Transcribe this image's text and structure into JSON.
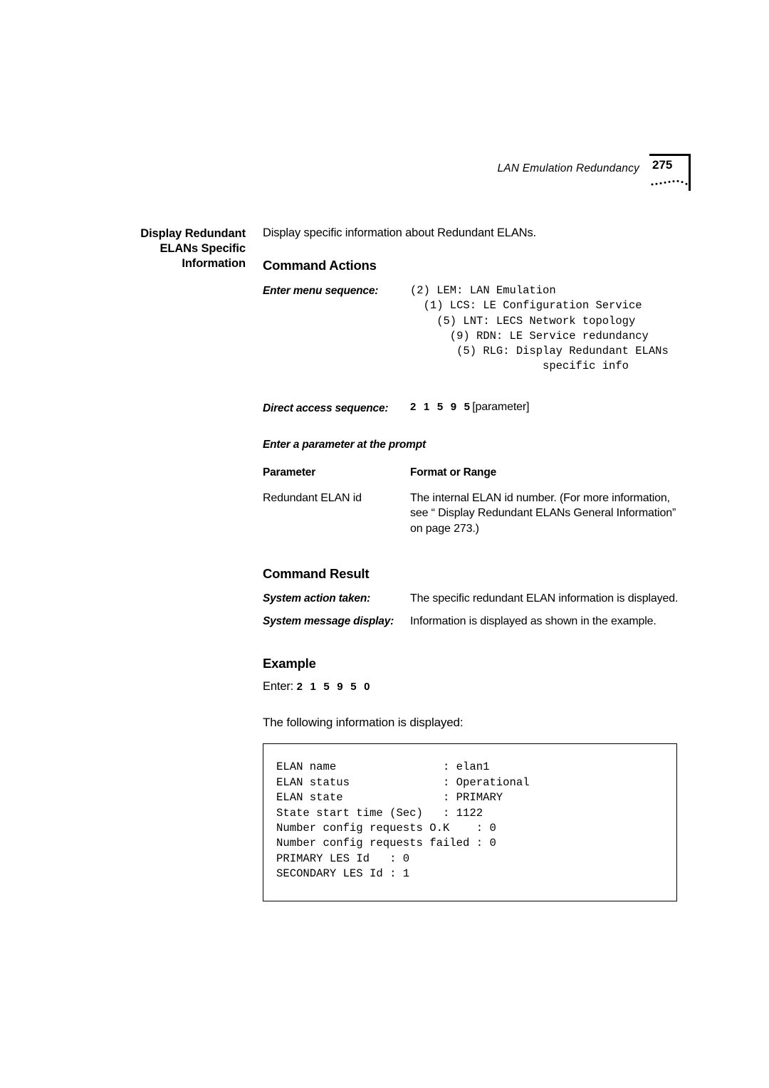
{
  "header": {
    "running_title": "LAN Emulation Redundancy",
    "page_number": "275"
  },
  "left_heading": {
    "line1": "Display Redundant",
    "line2": "ELANs Specific",
    "line3": "Information"
  },
  "intro": "Display specific information about Redundant ELANs.",
  "command_actions": {
    "heading": "Command Actions",
    "menu_sequence_label": "Enter menu sequence:",
    "menu_sequence_lines": [
      "(2) LEM: LAN Emulation",
      "  (1) LCS: LE Configuration Service",
      "    (5) LNT: LECS Network topology",
      "      (9) RDN: LE Service redundancy",
      "       (5) RLG: Display Redundant ELANs",
      "                    specific info"
    ],
    "direct_access_label": "Direct access sequence:",
    "direct_access_digits": "2 1 5 9 5",
    "direct_access_param": "[parameter]",
    "prompt_heading": "Enter a parameter at the prompt",
    "table": {
      "columns": [
        "Parameter",
        "Format or Range"
      ],
      "rows": [
        {
          "parameter": "Redundant ELAN id",
          "format_or_range": "The internal ELAN id number. (For more information, see “ Display Redundant ELANs General Information” on page 273.)"
        }
      ]
    }
  },
  "command_result": {
    "heading": "Command Result",
    "system_action_label": "System action taken:",
    "system_action_value": "The specific redundant ELAN information is displayed.",
    "system_message_label": "System message display:",
    "system_message_value": "Information is displayed as shown in the example."
  },
  "example": {
    "heading": "Example",
    "enter_prefix": "Enter:",
    "enter_digits": "2 1 5 9 5 0",
    "following_text": "The following information is displayed:",
    "output_text": "ELAN name                : elan1\nELAN status              : Operational\nELAN state               : PRIMARY\nState start time (Sec)   : 1122\nNumber config requests O.K    : 0\nNumber config requests failed : 0\nPRIMARY LES Id   : 0\nSECONDARY LES Id : 1"
  }
}
